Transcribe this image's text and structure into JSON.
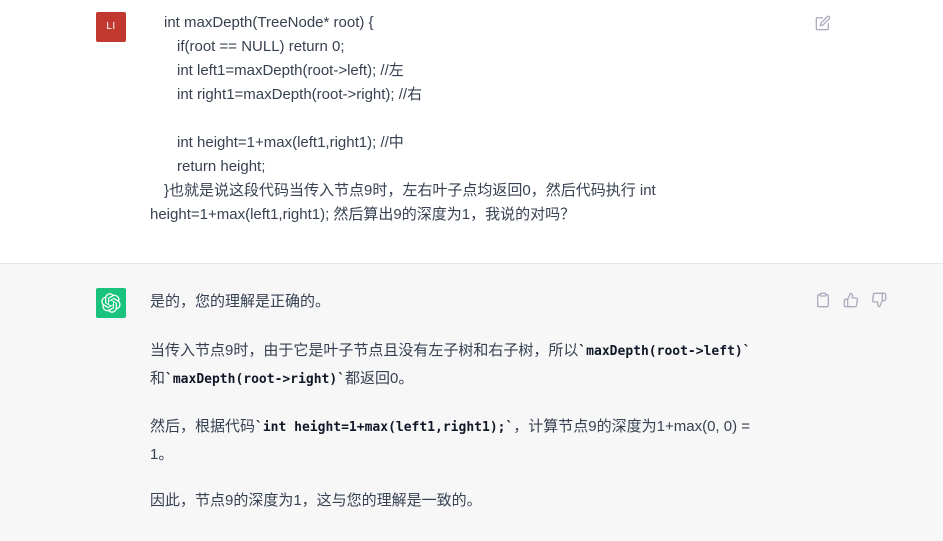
{
  "user_message": {
    "avatar_initials": "LI",
    "avatar_color": "#c1382f",
    "lines": [
      "int maxDepth(TreeNode* root) {",
      "if(root == NULL) return 0;",
      "int left1=maxDepth(root->left); //左",
      "int right1=maxDepth(root->right); //右",
      "int height=1+max(left1,right1); //中",
      "return height;",
      "}也就是说这段代码当传入节点9时，左右叶子点均返回0，然后代码执行 int",
      "height=1+max(left1,right1); 然后算出9的深度为1，我说的对吗？"
    ],
    "edit_icon": "edit-icon"
  },
  "assistant_message": {
    "avatar_color": "#19c37d",
    "avatar_icon": "openai-logo-icon",
    "p1": "是的，您的理解是正确的。",
    "p2": {
      "line1_prefix": "当传入节点9时，由于它是叶子节点且没有左子树和右子树，所以",
      "code1": "`maxDepth(root->left)`",
      "line2_prefix": "和",
      "code2": "`maxDepth(root->right)`",
      "line2_suffix": "都返回0。"
    },
    "p3": {
      "prefix": "然后，根据代码",
      "code": "`int height=1+max(left1,right1);`",
      "suffix": "，计算节点9的深度为1+max(0, 0) =",
      "line2": "1。"
    },
    "p4": "因此，节点9的深度为1，这与您的理解是一致的。",
    "actions": {
      "copy_icon": "clipboard-icon",
      "thumbs_up_icon": "thumbs-up-icon",
      "thumbs_down_icon": "thumbs-down-icon"
    }
  }
}
